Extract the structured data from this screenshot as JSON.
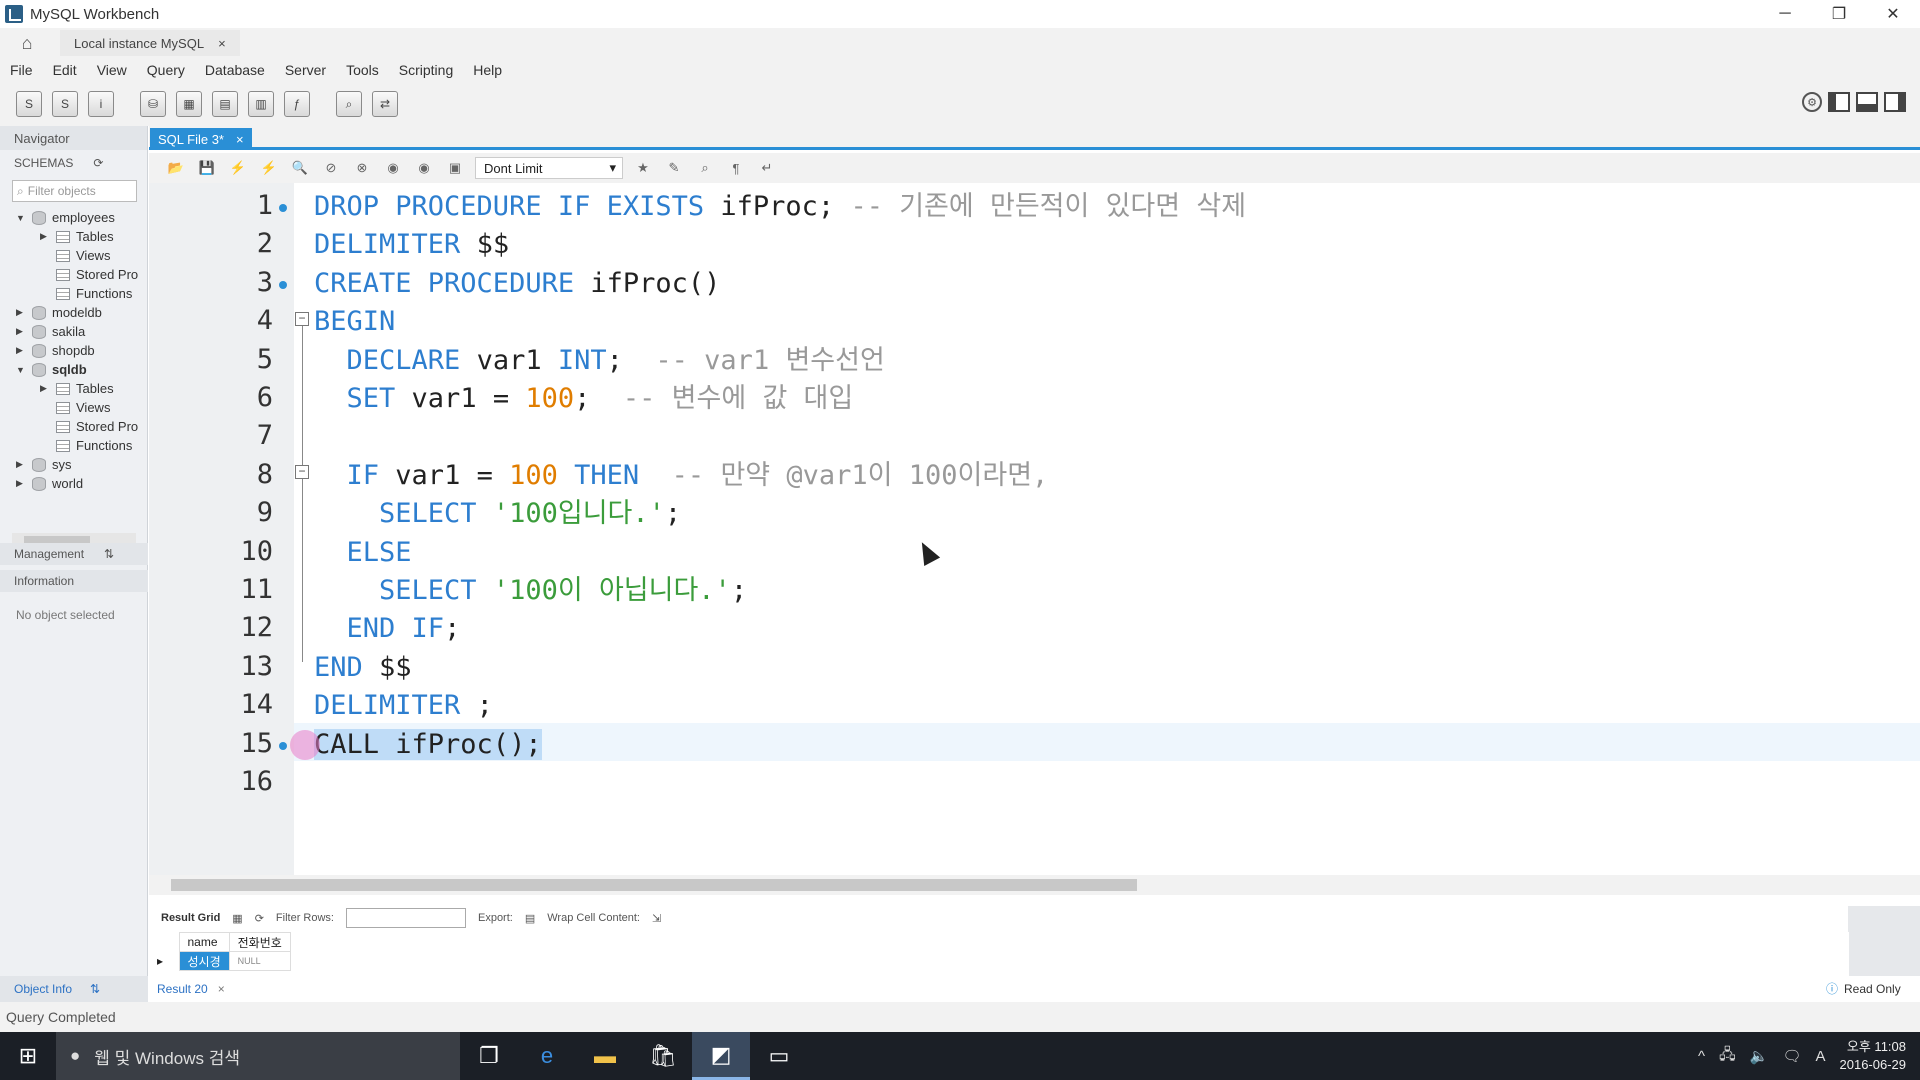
{
  "window": {
    "title": "MySQL Workbench",
    "minimize": "─",
    "restore": "❐",
    "close": "✕"
  },
  "conn_tab": {
    "label": "Local instance MySQL",
    "close": "×"
  },
  "menu": [
    "File",
    "Edit",
    "View",
    "Query",
    "Database",
    "Server",
    "Tools",
    "Scripting",
    "Help"
  ],
  "navigator": {
    "title": "Navigator",
    "schemas_label": "SCHEMAS",
    "filter_placeholder": "Filter objects",
    "tree": [
      {
        "label": "employees",
        "arrow": "▼",
        "type": "db",
        "bold": false
      },
      {
        "label": "Tables",
        "arrow": "▶",
        "type": "tbl",
        "indent": 1
      },
      {
        "label": "Views",
        "arrow": "",
        "type": "tbl",
        "indent": 1
      },
      {
        "label": "Stored Pro",
        "arrow": "",
        "type": "tbl",
        "indent": 1
      },
      {
        "label": "Functions",
        "arrow": "",
        "type": "tbl",
        "indent": 1
      },
      {
        "label": "modeldb",
        "arrow": "▶",
        "type": "db"
      },
      {
        "label": "sakila",
        "arrow": "▶",
        "type": "db"
      },
      {
        "label": "shopdb",
        "arrow": "▶",
        "type": "db"
      },
      {
        "label": "sqldb",
        "arrow": "▼",
        "type": "db",
        "bold": true
      },
      {
        "label": "Tables",
        "arrow": "▶",
        "type": "tbl",
        "indent": 1
      },
      {
        "label": "Views",
        "arrow": "",
        "type": "tbl",
        "indent": 1
      },
      {
        "label": "Stored Pro",
        "arrow": "",
        "type": "tbl",
        "indent": 1
      },
      {
        "label": "Functions",
        "arrow": "",
        "type": "tbl",
        "indent": 1
      },
      {
        "label": "sys",
        "arrow": "▶",
        "type": "db"
      },
      {
        "label": "world",
        "arrow": "▶",
        "type": "db"
      }
    ],
    "management": "Management",
    "information": "Information",
    "no_object": "No object selected",
    "object_info": "Object Info"
  },
  "editor": {
    "tab_label": "SQL File 3*",
    "tab_close": "×",
    "limit": "Dont Limit",
    "lines": [
      {
        "n": "1",
        "parts": [
          [
            "kw",
            "DROP PROCEDURE IF EXISTS "
          ],
          [
            "",
            "ifProc; "
          ],
          [
            "cmt",
            "-- 기존에 만든적이 있다면 삭제"
          ]
        ]
      },
      {
        "n": "2",
        "parts": [
          [
            "kw",
            "DELIMITER "
          ],
          [
            "",
            "$$"
          ]
        ]
      },
      {
        "n": "3",
        "parts": [
          [
            "kw",
            "CREATE PROCEDURE "
          ],
          [
            "",
            "ifProc()"
          ]
        ]
      },
      {
        "n": "4",
        "parts": [
          [
            "kw",
            "BEGIN"
          ]
        ]
      },
      {
        "n": "5",
        "parts": [
          [
            "",
            "  "
          ],
          [
            "kw",
            "DECLARE "
          ],
          [
            "",
            "var1 "
          ],
          [
            "kw",
            "INT"
          ],
          [
            "",
            ";  "
          ],
          [
            "cmt",
            "-- var1 변수선언"
          ]
        ]
      },
      {
        "n": "6",
        "parts": [
          [
            "",
            "  "
          ],
          [
            "kw",
            "SET "
          ],
          [
            "",
            "var1 = "
          ],
          [
            "num",
            "100"
          ],
          [
            "",
            ";  "
          ],
          [
            "cmt",
            "-- 변수에 값 대입"
          ]
        ]
      },
      {
        "n": "7",
        "parts": [
          [
            "",
            ""
          ]
        ]
      },
      {
        "n": "8",
        "parts": [
          [
            "",
            "  "
          ],
          [
            "kw",
            "IF "
          ],
          [
            "",
            "var1 = "
          ],
          [
            "num",
            "100 "
          ],
          [
            "kw",
            "THEN  "
          ],
          [
            "cmt",
            "-- 만약 @var1이 100이라면,"
          ]
        ]
      },
      {
        "n": "9",
        "parts": [
          [
            "",
            "    "
          ],
          [
            "kw",
            "SELECT "
          ],
          [
            "str",
            "'100입니다.'"
          ],
          [
            "",
            ";"
          ]
        ]
      },
      {
        "n": "10",
        "parts": [
          [
            "",
            "  "
          ],
          [
            "kw",
            "ELSE"
          ]
        ]
      },
      {
        "n": "11",
        "parts": [
          [
            "",
            "    "
          ],
          [
            "kw",
            "SELECT "
          ],
          [
            "str",
            "'100이 아닙니다.'"
          ],
          [
            "",
            ";"
          ]
        ]
      },
      {
        "n": "12",
        "parts": [
          [
            "",
            "  "
          ],
          [
            "kw",
            "END IF"
          ],
          [
            "",
            ";"
          ]
        ]
      },
      {
        "n": "13",
        "parts": [
          [
            "kw",
            "END "
          ],
          [
            "",
            "$$"
          ]
        ]
      },
      {
        "n": "14",
        "parts": [
          [
            "kw",
            "DELIMITER "
          ],
          [
            "",
            ";"
          ]
        ]
      },
      {
        "n": "15",
        "parts": [
          [
            "sel",
            "CALL ifProc();"
          ]
        ]
      },
      {
        "n": "16",
        "parts": [
          [
            "",
            ""
          ]
        ]
      }
    ]
  },
  "result": {
    "grid_label": "Result Grid",
    "filter_label": "Filter Rows:",
    "export_label": "Export:",
    "wrap_label": "Wrap Cell Content:",
    "columns": [
      "name",
      "전화번호"
    ],
    "row": [
      "성시경",
      "NULL"
    ],
    "tab_label": "Result 20",
    "tab_close": "×",
    "read_only": "Read Only"
  },
  "status": "Query Completed",
  "taskbar": {
    "search": "웹 및 Windows 검색",
    "time": "오후 11:08",
    "date": "2016-06-29",
    "ime": "A"
  }
}
